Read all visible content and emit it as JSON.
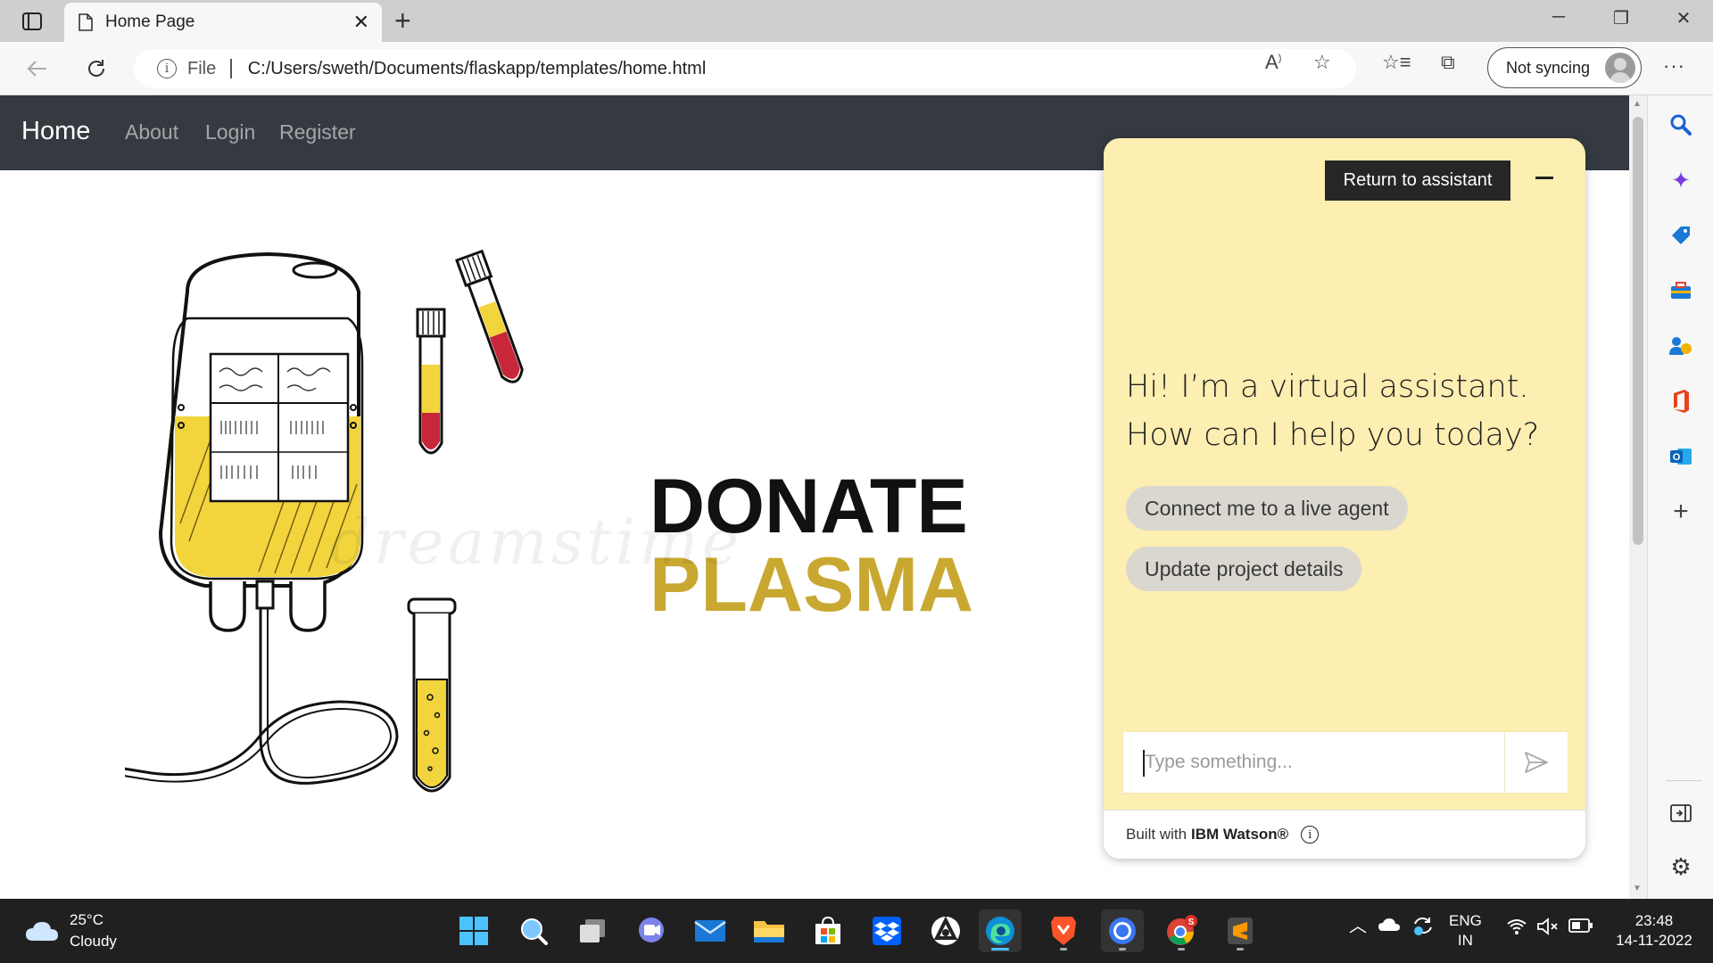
{
  "browser": {
    "tab": {
      "title": "Home Page"
    },
    "address": {
      "scheme_label": "File",
      "url": "C:/Users/sweth/Documents/flaskapp/templates/home.html"
    },
    "profile": {
      "sync_label": "Not syncing"
    }
  },
  "site_nav": {
    "brand": "Home",
    "links": [
      {
        "label": "About"
      },
      {
        "label": "Login"
      },
      {
        "label": "Register"
      }
    ]
  },
  "hero": {
    "headline_line1": "DONATE",
    "headline_line2": "PLASMA",
    "watermark": "dreamstime",
    "colors": {
      "plasma_yellow": "#c8a830",
      "blood_red": "#c8273a",
      "fluid_yellow": "#f2d43d"
    }
  },
  "chat": {
    "return_label": "Return to assistant",
    "greeting": "Hi! I’m a virtual assistant. How can I help you today?",
    "options": [
      {
        "label": "Connect me to a live agent"
      },
      {
        "label": "Update project details"
      }
    ],
    "input_placeholder": "Type something...",
    "footer_prefix": "Built with",
    "footer_brand": "IBM Watson®",
    "colors": {
      "panel": "#fdeeb1",
      "button": "#262626"
    }
  },
  "taskbar": {
    "weather": {
      "temp": "25°C",
      "condition": "Cloudy"
    },
    "language": {
      "lang": "ENG",
      "region": "IN"
    },
    "clock": {
      "time": "23:48",
      "date": "14-11-2022"
    },
    "chrome_badge": "S"
  }
}
